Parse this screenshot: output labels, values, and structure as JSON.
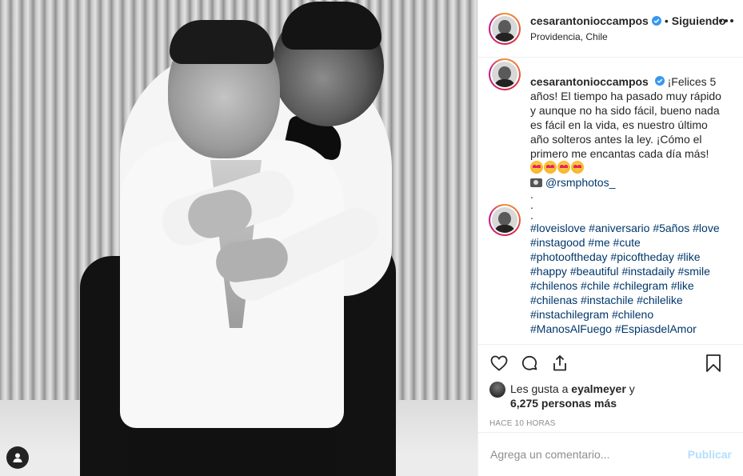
{
  "post": {
    "username": "cesarantonioccampos",
    "follow_status": "Siguiendo",
    "separator": "•",
    "location": "Providencia, Chile"
  },
  "caption": {
    "username": "cesarantonioccampos",
    "text": "¡Felices 5 años! El tiempo ha pasado muy rápido y aunque no ha sido fácil, bueno nada es fácil en la vida, es nuestro último año solteros antes la ley. ¡Cómo el primero me encantas cada día más!",
    "emoji_count": 4,
    "photo_credit": "@rsmphotos_",
    "dots": [
      ".",
      ".",
      "."
    ]
  },
  "hashtags_lines": [
    [
      "#loveislove",
      "#aniversario",
      "#5años",
      "#love"
    ],
    [
      "#instagood",
      "#me",
      "#cute"
    ],
    [
      "#photooftheday",
      "#picoftheday",
      "#like"
    ],
    [
      "#happy",
      "#beautiful",
      "#instadaily",
      "#smile"
    ],
    [
      "#chilenos",
      "#chile",
      "#chilegram",
      "#like"
    ],
    [
      "#chilenas",
      "#instachile",
      "#chilelike"
    ],
    [
      "#instachilegram",
      "#chileno"
    ],
    [
      "#ManosAlFuego",
      "#EspiasdelAmor"
    ]
  ],
  "likes": {
    "prefix": "Les gusta a",
    "user": "eyalmeyer",
    "suffix": "y",
    "count_text": "6,275 personas más"
  },
  "timestamp": "HACE 10 HORAS",
  "comment_box": {
    "placeholder": "Agrega un comentario...",
    "post_label": "Publicar"
  },
  "icons": {
    "like": "heart-icon",
    "comment": "comment-icon",
    "share": "share-icon",
    "save": "bookmark-icon",
    "more": "more-options-icon",
    "tag": "user-tag-icon",
    "verified": "verified-badge-icon"
  },
  "colors": {
    "link": "#00376b",
    "verified": "#3897f0",
    "muted": "#8e8e8e",
    "post_disabled": "#b2dffc"
  }
}
